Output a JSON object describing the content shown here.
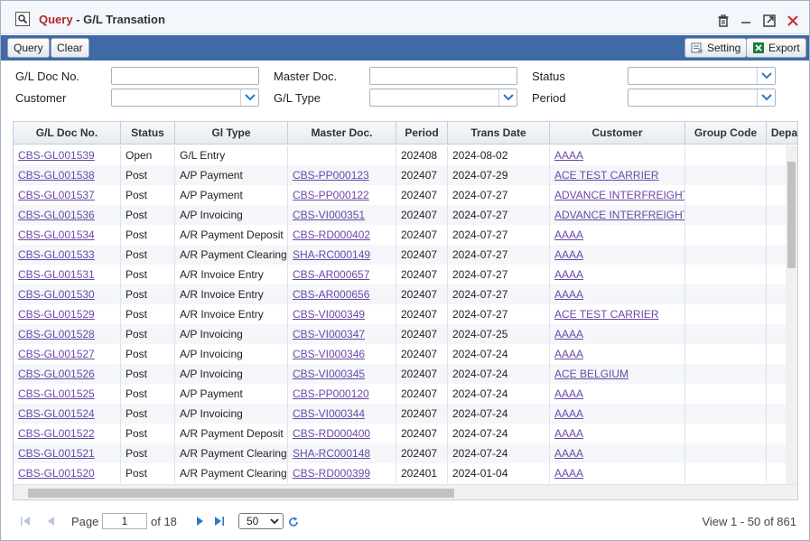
{
  "window": {
    "title_prefix": "Query",
    "title_sep": " - ",
    "title_main": "G/L Transation"
  },
  "toolbar": {
    "query_label": "Query",
    "clear_label": "Clear",
    "setting_label": "Setting",
    "export_label": "Export"
  },
  "filters": {
    "gl_doc_no_label": "G/L Doc No.",
    "gl_doc_no_value": "",
    "master_doc_label": "Master Doc.",
    "master_doc_value": "",
    "status_label": "Status",
    "status_value": "",
    "customer_label": "Customer",
    "customer_value": "",
    "gl_type_label": "G/L Type",
    "gl_type_value": "",
    "period_label": "Period",
    "period_value": ""
  },
  "grid": {
    "columns": [
      "G/L Doc No.",
      "Status",
      "Gl Type",
      "Master Doc.",
      "Period",
      "Trans Date",
      "Customer",
      "Group Code",
      "Depa"
    ],
    "rows": [
      [
        "CBS-GL001539",
        "Open",
        "G/L Entry",
        "",
        "202408",
        "2024-08-02",
        "AAAA",
        ""
      ],
      [
        "CBS-GL001538",
        "Post",
        "A/P Payment",
        "CBS-PP000123",
        "202407",
        "2024-07-29",
        "ACE TEST CARRIER",
        ""
      ],
      [
        "CBS-GL001537",
        "Post",
        "A/P Payment",
        "CBS-PP000122",
        "202407",
        "2024-07-27",
        "ADVANCE INTERFREIGHT",
        ""
      ],
      [
        "CBS-GL001536",
        "Post",
        "A/P Invoicing",
        "CBS-VI000351",
        "202407",
        "2024-07-27",
        "ADVANCE INTERFREIGHT",
        ""
      ],
      [
        "CBS-GL001534",
        "Post",
        "A/R Payment Deposit",
        "CBS-RD000402",
        "202407",
        "2024-07-27",
        "AAAA",
        ""
      ],
      [
        "CBS-GL001533",
        "Post",
        "A/R Payment Clearing",
        "SHA-RC000149",
        "202407",
        "2024-07-27",
        "AAAA",
        ""
      ],
      [
        "CBS-GL001531",
        "Post",
        "A/R Invoice Entry",
        "CBS-AR000657",
        "202407",
        "2024-07-27",
        "AAAA",
        ""
      ],
      [
        "CBS-GL001530",
        "Post",
        "A/R Invoice Entry",
        "CBS-AR000656",
        "202407",
        "2024-07-27",
        "AAAA",
        ""
      ],
      [
        "CBS-GL001529",
        "Post",
        "A/R Invoice Entry",
        "CBS-VI000349",
        "202407",
        "2024-07-27",
        "ACE TEST CARRIER",
        ""
      ],
      [
        "CBS-GL001528",
        "Post",
        "A/P Invoicing",
        "CBS-VI000347",
        "202407",
        "2024-07-25",
        "AAAA",
        ""
      ],
      [
        "CBS-GL001527",
        "Post",
        "A/P Invoicing",
        "CBS-VI000346",
        "202407",
        "2024-07-24",
        "AAAA",
        ""
      ],
      [
        "CBS-GL001526",
        "Post",
        "A/P Invoicing",
        "CBS-VI000345",
        "202407",
        "2024-07-24",
        "ACE BELGIUM",
        ""
      ],
      [
        "CBS-GL001525",
        "Post",
        "A/P Payment",
        "CBS-PP000120",
        "202407",
        "2024-07-24",
        "AAAA",
        ""
      ],
      [
        "CBS-GL001524",
        "Post",
        "A/P Invoicing",
        "CBS-VI000344",
        "202407",
        "2024-07-24",
        "AAAA",
        ""
      ],
      [
        "CBS-GL001522",
        "Post",
        "A/R Payment Deposit",
        "CBS-RD000400",
        "202407",
        "2024-07-24",
        "AAAA",
        ""
      ],
      [
        "CBS-GL001521",
        "Post",
        "A/R Payment Clearing",
        "SHA-RC000148",
        "202407",
        "2024-07-24",
        "AAAA",
        ""
      ],
      [
        "CBS-GL001520",
        "Post",
        "A/R Payment Clearing",
        "CBS-RD000399",
        "202401",
        "2024-01-04",
        "AAAA",
        ""
      ]
    ],
    "vertical_scroll_fraction": 0.0,
    "horizontal_scroll_fraction": 0.0
  },
  "pager": {
    "page_label": "Page",
    "page_value": "1",
    "of_label": "of 18",
    "page_size": "50",
    "view_text": "View 1 - 50 of 861"
  },
  "colors": {
    "title_accent": "#b3262a",
    "toolbar_bg": "#3f6aa6",
    "link": "#6a49a8",
    "close_red": "#d0282e"
  }
}
